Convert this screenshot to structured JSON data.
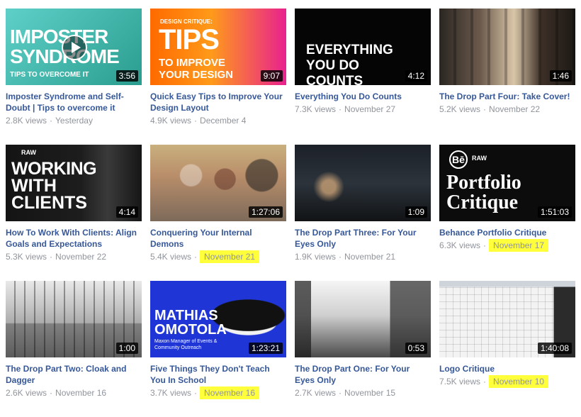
{
  "highlight_color": "#ffff3b",
  "link_color": "#365899",
  "videos": [
    {
      "title": "Imposter Syndrome and Self-Doubt | Tips to overcome it",
      "views": "2.8K views",
      "date": "Yesterday",
      "duration": "3:56",
      "thumb_text": [
        "IMPOSTER",
        "SYNDROME",
        "TIPS TO OVERCOME IT"
      ]
    },
    {
      "title": "Quick Easy Tips to Improve Your Design Layout",
      "views": "4.9K views",
      "date": "December 4",
      "duration": "9:07",
      "thumb_text": [
        "DESIGN CRITIQUE:",
        "TIPS",
        "TO IMPROVE",
        "YOUR DESIGN"
      ]
    },
    {
      "title": "Everything You Do Counts",
      "views": "7.3K views",
      "date": "November 27",
      "duration": "4:12",
      "thumb_text": [
        "EVERYTHING",
        "YOU DO",
        "COUNTS"
      ]
    },
    {
      "title": "The Drop Part Four: Take Cover!",
      "views": "5.2K views",
      "date": "November 22",
      "duration": "1:46",
      "thumb_text": []
    },
    {
      "title": "How To Work With Clients: Align Goals and Expectations",
      "views": "5.3K views",
      "date": "November 22",
      "duration": "4:14",
      "thumb_text": [
        "RAW",
        "WORKING",
        "WITH",
        "CLIENTS"
      ]
    },
    {
      "title": "Conquering Your Internal Demons",
      "views": "5.4K views",
      "date": "November 21",
      "duration": "1:27:06",
      "thumb_text": [],
      "highlight": true
    },
    {
      "title": "The Drop Part Three: For Your Eyes Only",
      "views": "1.9K views",
      "date": "November 21",
      "duration": "1:09",
      "thumb_text": []
    },
    {
      "title": "Behance Portfolio Critique",
      "views": "6.3K views",
      "date": "November 17",
      "duration": "1:51:03",
      "thumb_text": [
        "Bē",
        "RAW",
        "Portfolio",
        "Critique"
      ],
      "highlight": true
    },
    {
      "title": "The Drop Part Two: Cloak and Dagger",
      "views": "2.6K views",
      "date": "November 16",
      "duration": "1:00",
      "thumb_text": []
    },
    {
      "title": "Five Things They Don't Teach You In School",
      "views": "3.7K views",
      "date": "November 16",
      "duration": "1:23:21",
      "thumb_text": [
        "MATHIAS",
        "OMOTOLA",
        "Maxon Manager of Events &",
        "Community Outreach"
      ],
      "highlight": true
    },
    {
      "title": "The Drop Part One: For Your Eyes Only",
      "views": "2.7K views",
      "date": "November 15",
      "duration": "0:53",
      "thumb_text": []
    },
    {
      "title": "Logo Critique",
      "views": "7.5K views",
      "date": "November 10",
      "duration": "1:40:08",
      "thumb_text": [],
      "highlight": true
    }
  ]
}
